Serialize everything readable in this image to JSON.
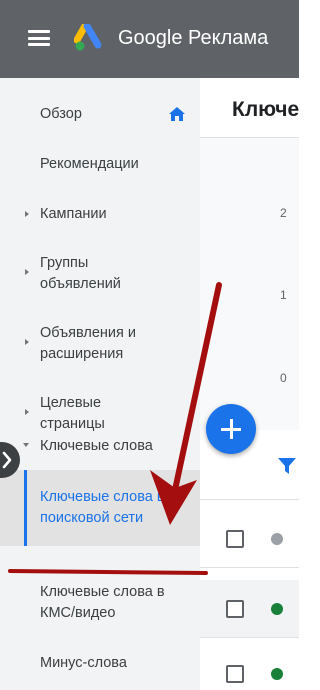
{
  "header": {
    "app_title": "Google Реклама"
  },
  "sidebar": {
    "items": [
      {
        "label": "Обзор"
      },
      {
        "label": "Рекомендации"
      },
      {
        "label": "Кампании"
      },
      {
        "label": "Группы\nобъявлений"
      },
      {
        "label": "Объявления и\nрасширения"
      },
      {
        "label": "Целевые\nстраницы"
      },
      {
        "label": "Ключевые слова"
      },
      {
        "label": "Ключевые слова в\nпоисковой сети"
      },
      {
        "label": "Ключевые слова в\nКМС/видео"
      },
      {
        "label": "Минус-слова"
      }
    ]
  },
  "main": {
    "page_title": "Ключе",
    "chart_ticks": [
      "2",
      "1",
      "0"
    ]
  },
  "table": {
    "rows": [
      {
        "status_color": "#9aa0a6"
      },
      {
        "status_color": "#188038"
      },
      {
        "status_color": "#188038"
      }
    ]
  },
  "colors": {
    "header_bg": "#5f6368",
    "accent": "#1a73e8",
    "annotation_arrow": "#a50e0e"
  }
}
